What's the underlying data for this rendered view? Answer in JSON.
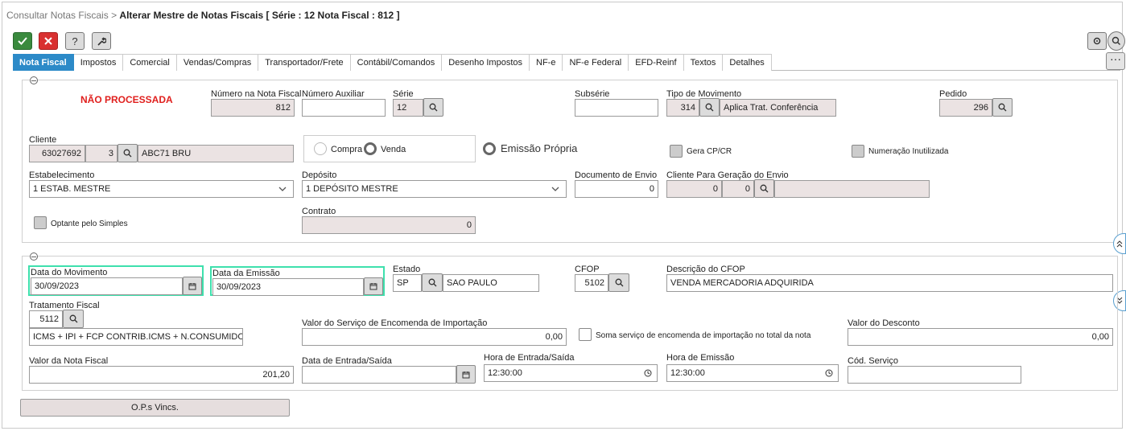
{
  "breadcrumb": {
    "parent": "Consultar Notas Fiscais",
    "sep": ">",
    "current": "Alterar Mestre de Notas Fiscais [ Série : 12 Nota Fiscal : 812 ]"
  },
  "toolbar": {
    "help": "?"
  },
  "tabs": [
    "Nota Fiscal",
    "Impostos",
    "Comercial",
    "Vendas/Compras",
    "Transportador/Frete",
    "Contábil/Comandos",
    "Desenho Impostos",
    "NF-e",
    "NF-e Federal",
    "EFD-Reinf",
    "Textos",
    "Detalhes"
  ],
  "status": "NÃO PROCESSADA",
  "s1": {
    "numero_nf": {
      "label": "Número na Nota Fiscal",
      "value": "812"
    },
    "numero_aux": {
      "label": "Número Auxiliar",
      "value": ""
    },
    "serie": {
      "label": "Série",
      "value": "12"
    },
    "subserie": {
      "label": "Subsérie",
      "value": ""
    },
    "tipo_mov": {
      "label": "Tipo de Movimento",
      "code": "314",
      "desc": "Aplica Trat. Conferência"
    },
    "pedido": {
      "label": "Pedido",
      "value": "296"
    },
    "cliente": {
      "label": "Cliente",
      "code": "63027692",
      "seq": "3",
      "name": "ABC71 BRU"
    },
    "compra": "Compra",
    "venda": "Venda",
    "emissao": "Emissão Própria",
    "gera_cp": "Gera CP/CR",
    "num_inut": "Numeração Inutilizada",
    "estab": {
      "label": "Estabelecimento",
      "value": "1 ESTAB. MESTRE"
    },
    "deposito": {
      "label": "Depósito",
      "value": "1 DEPÓSITO MESTRE"
    },
    "doc_envio": {
      "label": "Documento de Envio",
      "value": "0"
    },
    "cli_envio": {
      "label": "Cliente Para Geração do Envio",
      "v1": "0",
      "v2": "0"
    },
    "optante": "Optante pelo Simples",
    "contrato": {
      "label": "Contrato",
      "value": "0"
    }
  },
  "s2": {
    "data_mov": {
      "label": "Data do Movimento",
      "value": "30/09/2023"
    },
    "data_emi": {
      "label": "Data da Emissão",
      "value": "30/09/2023"
    },
    "estado": {
      "label": "Estado",
      "code": "SP",
      "name": "SAO PAULO"
    },
    "cfop": {
      "label": "CFOP",
      "value": "5102"
    },
    "desc_cfop": {
      "label": "Descrição do CFOP",
      "value": "VENDA MERCADORIA ADQUIRIDA"
    },
    "trat": {
      "label": "Tratamento Fiscal",
      "code": "5112",
      "desc": "ICMS + IPI + FCP CONTRIB.ICMS + N.CONSUMIDOR FINAL"
    },
    "valor_serv": {
      "label": "Valor do Serviço de Encomenda de Importação",
      "value": "0,00"
    },
    "soma": "Soma serviço de encomenda de importação no total da nota",
    "desconto": {
      "label": "Valor do Desconto",
      "value": "0,00"
    },
    "valor_nf": {
      "label": "Valor da Nota Fiscal",
      "value": "201,20"
    },
    "data_es": {
      "label": "Data de Entrada/Saída",
      "value": ""
    },
    "hora_es": {
      "label": "Hora de Entrada/Saída",
      "value": "12:30:00"
    },
    "hora_emi": {
      "label": "Hora de Emissão",
      "value": "12:30:00"
    },
    "cod_serv": {
      "label": "Cód. Serviço",
      "value": ""
    }
  },
  "ops": "O.P.s Vincs.",
  "colors": {
    "accent": "#2c8ac8",
    "status": "#e0201e",
    "focus": "#3ee0ad"
  }
}
